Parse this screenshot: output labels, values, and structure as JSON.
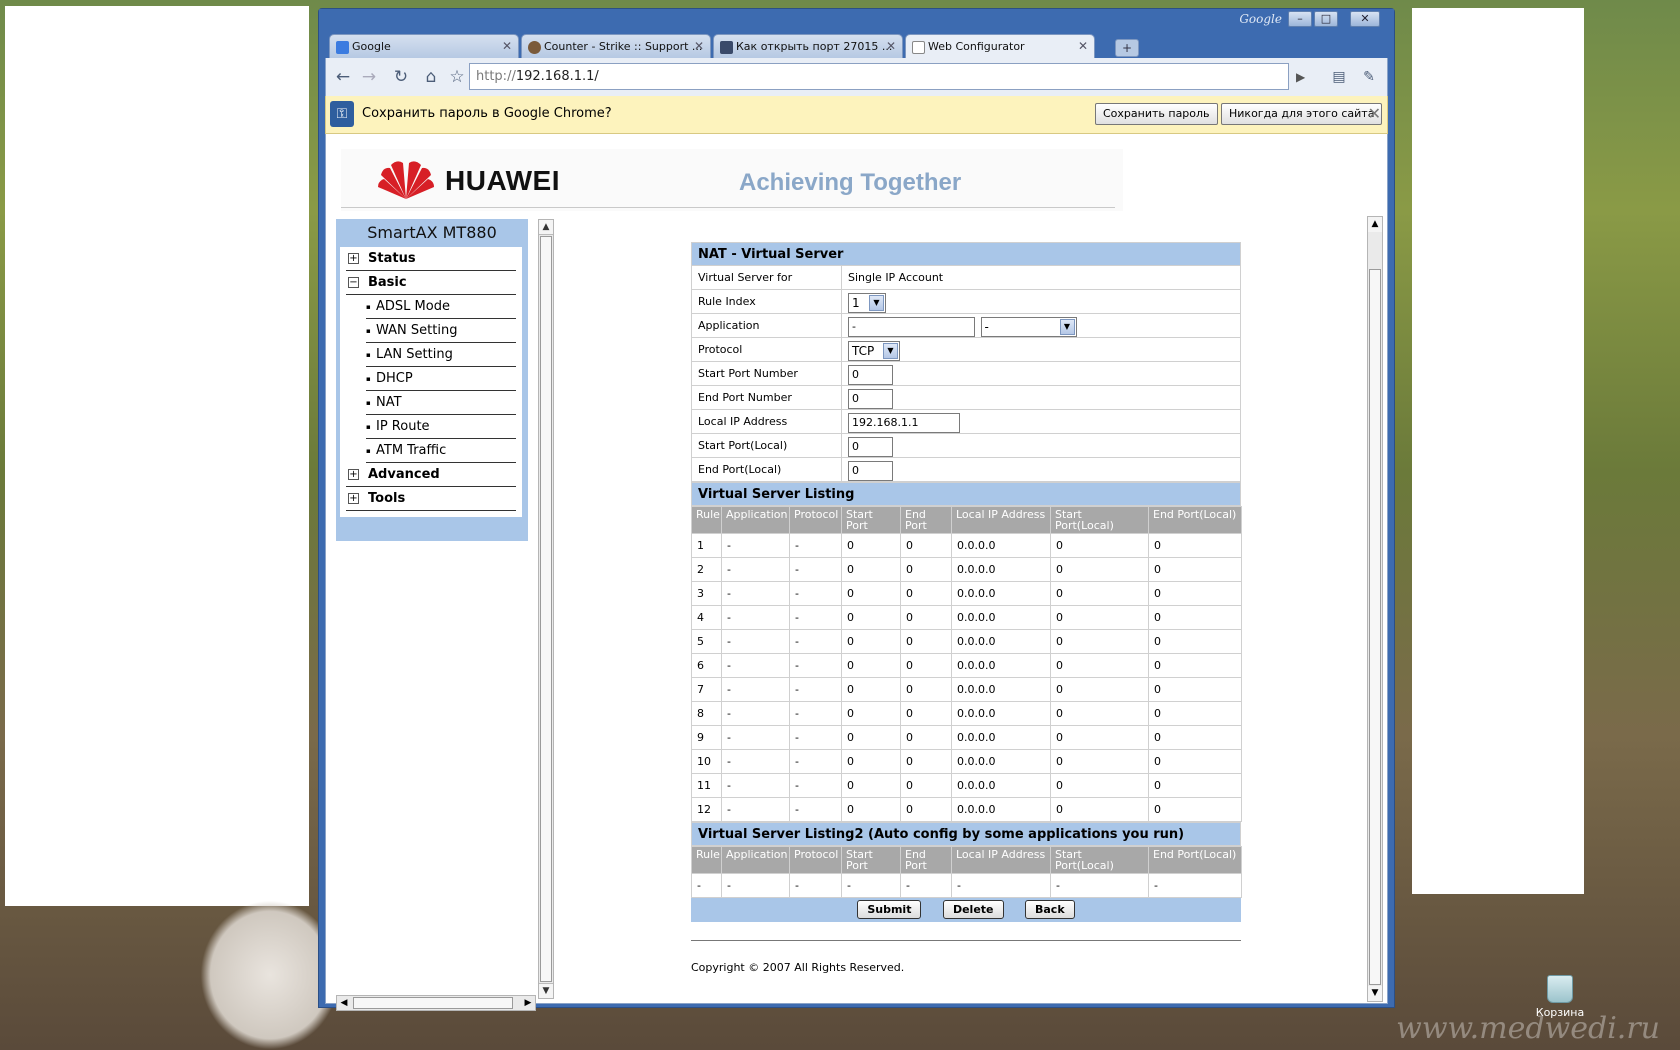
{
  "browser": {
    "brand_word": "Google",
    "tabs": [
      {
        "title": "Google",
        "favicon_color": "#3b7be0"
      },
      {
        "title": "Counter - Strike :: Support ...",
        "favicon_color": "#7a5a3a"
      },
      {
        "title": "Как открыть порт 27015 ...",
        "favicon_color": "#3a4a6a"
      },
      {
        "title": "Web Configurator",
        "favicon_color": "#e8e8e8"
      }
    ],
    "address": {
      "scheme": "http://",
      "host": "192.168.1.1/"
    },
    "infobar": {
      "message": "Сохранить пароль в Google Chrome?",
      "save_label": "Сохранить пароль",
      "never_label": "Никогда для этого сайта"
    }
  },
  "banner": {
    "brand": "HUAWEI",
    "tagline": "Achieving Together",
    "logo_color": "#d71f26"
  },
  "menu": {
    "title": "SmartAX MT880",
    "items": [
      {
        "label": "Status",
        "level": "top",
        "sign": "+"
      },
      {
        "label": "Basic",
        "level": "top",
        "sign": "−"
      },
      {
        "label": "ADSL Mode",
        "level": "sub"
      },
      {
        "label": "WAN Setting",
        "level": "sub"
      },
      {
        "label": "LAN Setting",
        "level": "sub"
      },
      {
        "label": "DHCP",
        "level": "sub"
      },
      {
        "label": "NAT",
        "level": "sub"
      },
      {
        "label": "IP Route",
        "level": "sub"
      },
      {
        "label": "ATM Traffic",
        "level": "sub"
      },
      {
        "label": "Advanced",
        "level": "top",
        "sign": "+"
      },
      {
        "label": "Tools",
        "level": "top",
        "sign": "+"
      }
    ]
  },
  "form": {
    "title": "NAT - Virtual Server",
    "virtual_server_for_label": "Virtual Server for",
    "virtual_server_for_value": "Single IP Account",
    "rule_index_label": "Rule Index",
    "rule_index_value": "1",
    "application_label": "Application",
    "application_value": "-",
    "application_select": "-",
    "protocol_label": "Protocol",
    "protocol_value": "TCP",
    "start_port_label": "Start Port Number",
    "start_port_value": "0",
    "end_port_label": "End Port Number",
    "end_port_value": "0",
    "local_ip_label": "Local IP Address",
    "local_ip_value": "192.168.1.1",
    "start_port_local_label": "Start Port(Local)",
    "start_port_local_value": "0",
    "end_port_local_label": "End Port(Local)",
    "end_port_local_value": "0"
  },
  "listing": {
    "title": "Virtual Server Listing",
    "headers": [
      "Rule",
      "Application",
      "Protocol",
      "Start Port",
      "End Port",
      "Local IP Address",
      "Start Port(Local)",
      "End Port(Local)"
    ],
    "rows": [
      [
        "1",
        "-",
        "-",
        "0",
        "0",
        "0.0.0.0",
        "0",
        "0"
      ],
      [
        "2",
        "-",
        "-",
        "0",
        "0",
        "0.0.0.0",
        "0",
        "0"
      ],
      [
        "3",
        "-",
        "-",
        "0",
        "0",
        "0.0.0.0",
        "0",
        "0"
      ],
      [
        "4",
        "-",
        "-",
        "0",
        "0",
        "0.0.0.0",
        "0",
        "0"
      ],
      [
        "5",
        "-",
        "-",
        "0",
        "0",
        "0.0.0.0",
        "0",
        "0"
      ],
      [
        "6",
        "-",
        "-",
        "0",
        "0",
        "0.0.0.0",
        "0",
        "0"
      ],
      [
        "7",
        "-",
        "-",
        "0",
        "0",
        "0.0.0.0",
        "0",
        "0"
      ],
      [
        "8",
        "-",
        "-",
        "0",
        "0",
        "0.0.0.0",
        "0",
        "0"
      ],
      [
        "9",
        "-",
        "-",
        "0",
        "0",
        "0.0.0.0",
        "0",
        "0"
      ],
      [
        "10",
        "-",
        "-",
        "0",
        "0",
        "0.0.0.0",
        "0",
        "0"
      ],
      [
        "11",
        "-",
        "-",
        "0",
        "0",
        "0.0.0.0",
        "0",
        "0"
      ],
      [
        "12",
        "-",
        "-",
        "0",
        "0",
        "0.0.0.0",
        "0",
        "0"
      ]
    ]
  },
  "listing2": {
    "title": "Virtual Server Listing2 (Auto config by some applications you run)",
    "headers": [
      "Rule",
      "Application",
      "Protocol",
      "Start Port",
      "End Port",
      "Local IP Address",
      "Start Port(Local)",
      "End Port(Local)"
    ],
    "rows": [
      [
        "-",
        "-",
        "-",
        "-",
        "-",
        "-",
        "-",
        "-"
      ]
    ]
  },
  "actions": {
    "submit": "Submit",
    "delete": "Delete",
    "back": "Back"
  },
  "copyright": "Copyright © 2007 All Rights Reserved.",
  "desktop": {
    "recycle_label": "Корзина",
    "watermark": "www.medwedi.ru"
  }
}
